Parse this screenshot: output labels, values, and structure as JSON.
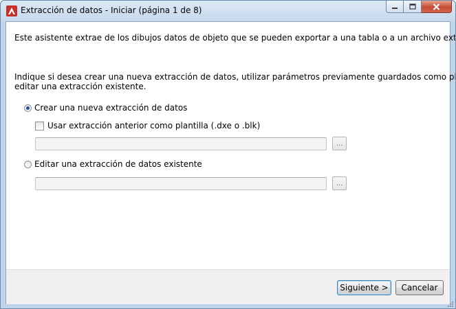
{
  "window": {
    "title": "Extracción de datos - Iniciar (página 1 de 8)"
  },
  "content": {
    "intro": "Este asistente extrae de los dibujos datos de objeto que se pueden exportar a una tabla o a un archivo externo.",
    "instruction_line1": "Indique si desea crear una nueva extracción de datos, utilizar parámetros previamente guardados como plantilla o",
    "instruction_line2": "editar una extracción existente.",
    "option_new": {
      "label": "Crear una nueva extracción de datos",
      "selected": true
    },
    "use_template": {
      "label": "Usar extracción anterior como plantilla (.dxe o .blk)",
      "checked": false,
      "value": ""
    },
    "option_edit": {
      "label": "Editar una extracción de datos existente",
      "selected": false,
      "value": ""
    },
    "browse_label": "..."
  },
  "footer": {
    "next_label": "Siguiente >",
    "cancel_label": "Cancelar"
  },
  "colors": {
    "title_bar": "#c6d8ec",
    "close_button": "#c74b33",
    "radio_dot": "#1e4f9a",
    "default_button_border": "#3c7fb1"
  }
}
